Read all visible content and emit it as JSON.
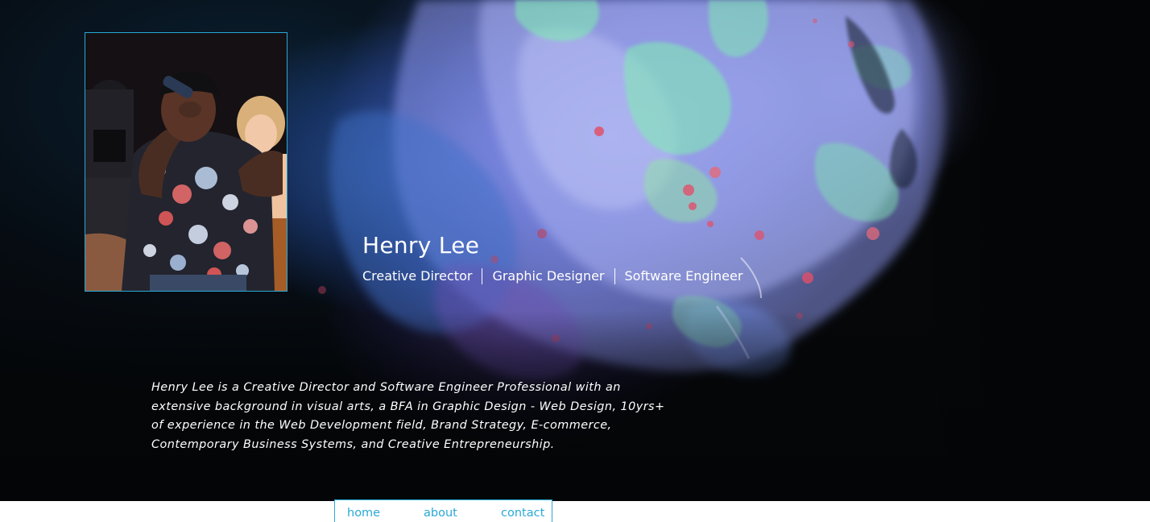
{
  "profile": {
    "name": "Henry Lee",
    "titles": [
      "Creative Director",
      "Graphic Designer",
      "Software Engineer"
    ],
    "bio": "Henry Lee is a Creative Director and Software Engineer Professional with an extensive background in visual arts, a BFA in Graphic Design - Web Design, 10yrs+ of experience in the Web Development field, Brand Strategy, E-commerce, Contemporary Business Systems, and Creative Entrepreneurship."
  },
  "nav": {
    "items": [
      {
        "label": "home"
      },
      {
        "label": "about"
      },
      {
        "label": "contact"
      }
    ]
  },
  "colors": {
    "accent": "#29a9d6",
    "background": "#040608",
    "text": "#ffffff",
    "splash_blue": "#8d98f0",
    "splash_green": "#7ef0b0",
    "splash_red": "#e0506a"
  }
}
